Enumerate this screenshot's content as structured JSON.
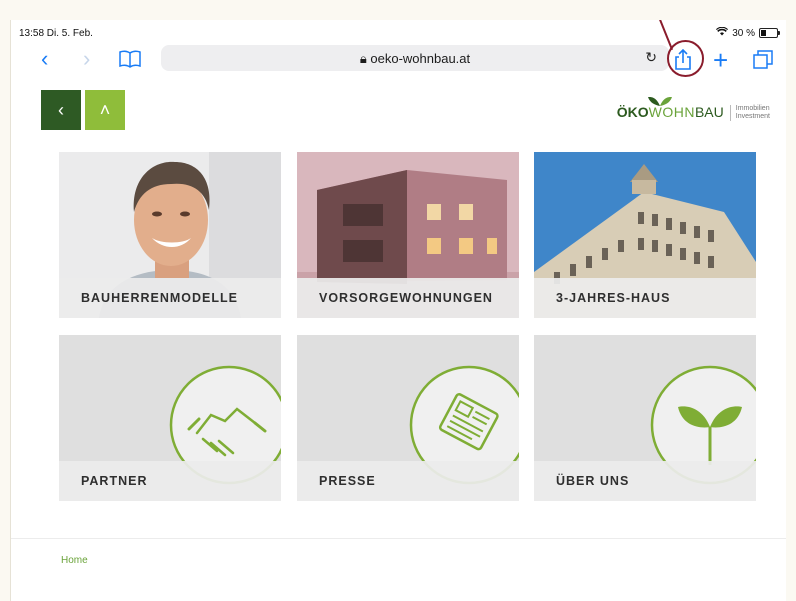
{
  "status_bar": {
    "time": "13:58  Di. 5. Feb.",
    "battery": "30 %",
    "battery_level": 0.3
  },
  "browser": {
    "url": "oeko-wohnbau.at",
    "icons": [
      "back-icon",
      "forward-icon",
      "bookmarks-icon",
      "lock-icon",
      "reload-icon",
      "share-icon",
      "new-tab-icon",
      "tabs-icon"
    ]
  },
  "site": {
    "logo": {
      "oko": "ÖKO",
      "wohn": "WOHN",
      "bau": "BAU",
      "sub1": "Immobilien",
      "sub2": "Investment"
    },
    "tiles": [
      {
        "label": "BAUHERRENMODELLE"
      },
      {
        "label": "VORSORGEWOHNUNGEN"
      },
      {
        "label": "3-JAHRES-HAUS"
      },
      {
        "label": "PARTNER"
      },
      {
        "label": "PRESSE"
      },
      {
        "label": "ÜBER UNS"
      }
    ],
    "breadcrumb": "Home"
  },
  "colors": {
    "accent_green": "#8fbd3a",
    "dark_green": "#2e5a24",
    "ios_blue": "#1a7cf5",
    "annotation": "#8a1c2c"
  }
}
